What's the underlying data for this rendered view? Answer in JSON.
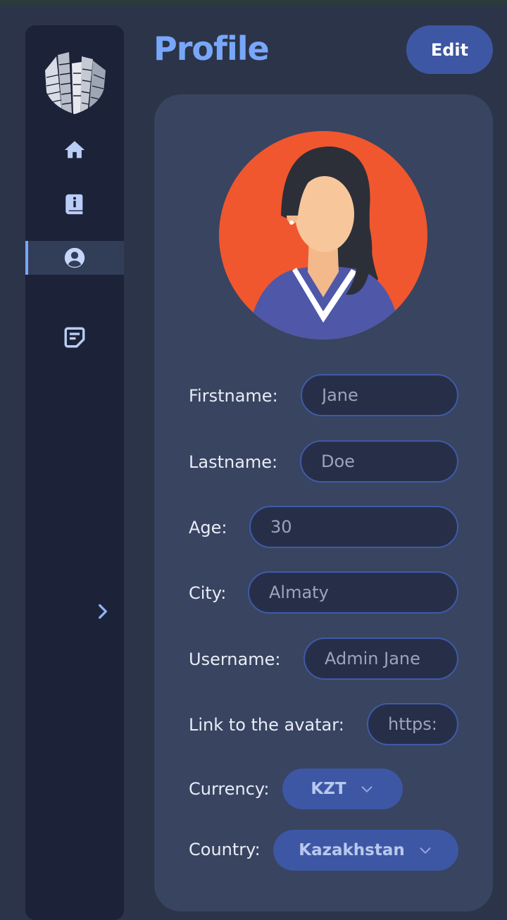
{
  "header": {
    "title": "Profile",
    "edit_label": "Edit"
  },
  "sidebar": {
    "items": [
      {
        "icon": "home-icon"
      },
      {
        "icon": "info-book-icon"
      },
      {
        "icon": "user-circle-icon",
        "active": true
      },
      {
        "icon": "note-icon"
      }
    ],
    "expand_icon": "chevron-right-icon"
  },
  "form": {
    "firstname": {
      "label": "Firstname:",
      "placeholder": "Jane"
    },
    "lastname": {
      "label": "Lastname:",
      "placeholder": "Doe"
    },
    "age": {
      "label": "Age:",
      "placeholder": "30"
    },
    "city": {
      "label": "City:",
      "placeholder": "Almaty"
    },
    "username": {
      "label": "Username:",
      "placeholder": "Admin Jane"
    },
    "avatar_link": {
      "label": "Link to the avatar:",
      "placeholder": "https:"
    },
    "currency": {
      "label": "Currency:",
      "value": "KZT"
    },
    "country": {
      "label": "Country:",
      "value": "Kazakhstan"
    }
  },
  "colors": {
    "accent": "#78a7fa",
    "button": "#3d57a4",
    "sidebar": "#1c2238",
    "card": "#384460",
    "background": "#2b3448",
    "avatar_bg": "#f0572e"
  }
}
